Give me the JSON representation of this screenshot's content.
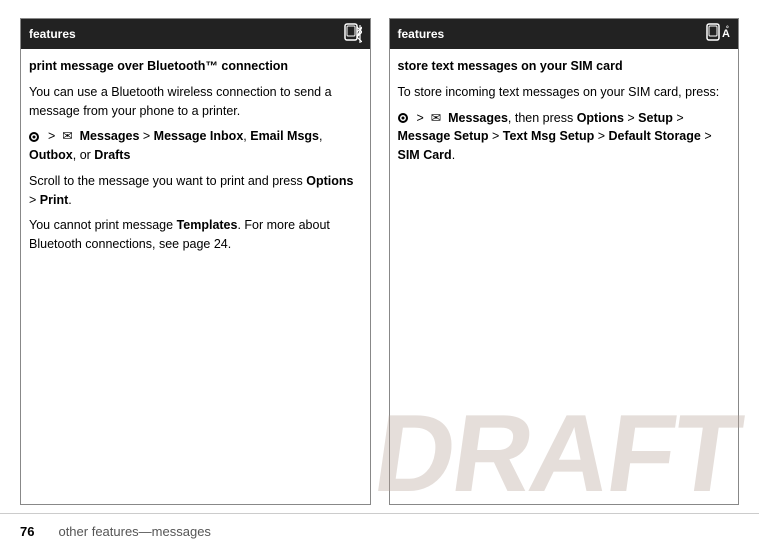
{
  "page": {
    "footer": {
      "page_number": "76",
      "page_text": "other features—messages"
    }
  },
  "cards": [
    {
      "id": "card-left",
      "header_label": "features",
      "title": "print message over Bluetooth™ connection",
      "paragraphs": [
        "You can use a Bluetooth wireless connection to send a message from your phone to a printer.",
        "NAV > MSG Messages > Message Inbox, Email Msgs, Outbox, or Drafts",
        "Scroll to the message you want to print and press Options > Print.",
        "You cannot print message Templates. For more about Bluetooth connections, see page 24."
      ]
    },
    {
      "id": "card-right",
      "header_label": "features",
      "title": "store text messages on your SIM card",
      "paragraphs": [
        "To store incoming text messages on your SIM card, press:",
        "NAV > MSG Messages, then press Options > Setup > Message Setup > Text Msg Setup > Default Storage > SIM Card."
      ]
    }
  ],
  "draft_watermark": "DRAFT"
}
